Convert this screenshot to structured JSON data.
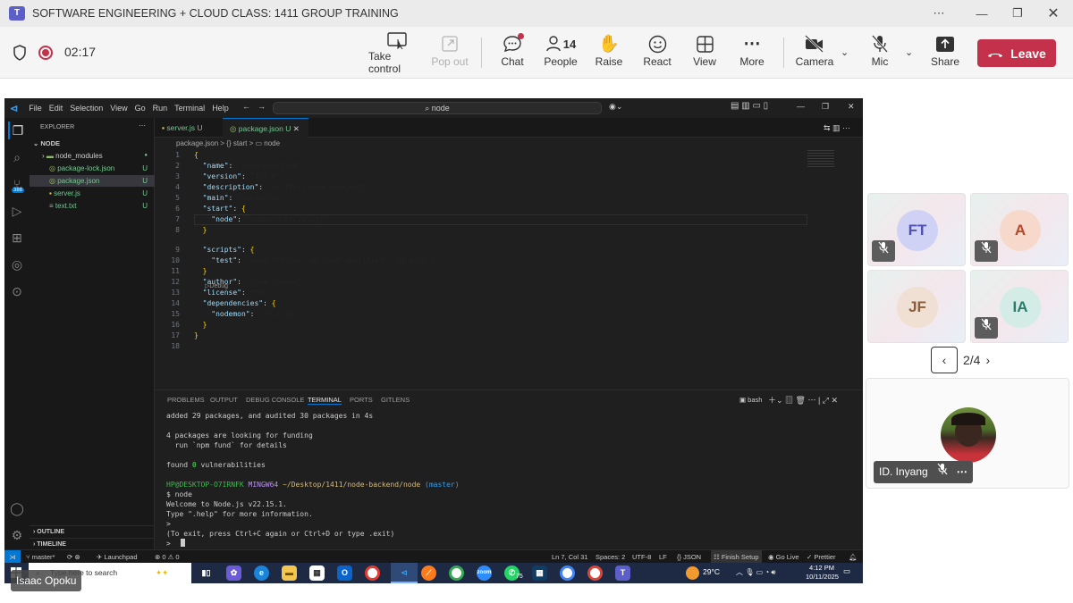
{
  "window": {
    "title": "SOFTWARE ENGINEERING + CLOUD CLASS: 1411 GROUP TRAINING"
  },
  "meeting": {
    "timer": "02:17",
    "tools": {
      "take_control": "Take control",
      "pop_out": "Pop out",
      "chat": "Chat",
      "people": "People",
      "people_count": "14",
      "raise": "Raise",
      "react": "React",
      "view": "View",
      "more": "More",
      "camera": "Camera",
      "mic": "Mic",
      "share": "Share"
    },
    "leave_label": "Leave"
  },
  "vscode": {
    "menu": [
      "File",
      "Edit",
      "Selection",
      "View",
      "Go",
      "Run",
      "Terminal",
      "Help"
    ],
    "search": "node",
    "explorer": {
      "header": "EXPLORER",
      "root": "NODE",
      "items": [
        {
          "name": "node_modules",
          "badge": "●"
        },
        {
          "name": "package-lock.json",
          "badge": "U"
        },
        {
          "name": "package.json",
          "badge": "U"
        },
        {
          "name": "server.js",
          "badge": "U"
        },
        {
          "name": "text.txt",
          "badge": "U"
        }
      ],
      "outline": "OUTLINE",
      "timeline": "TIMELINE",
      "scm_badge": "388"
    },
    "tabs": [
      {
        "label": "server.js",
        "badge": "U"
      },
      {
        "label": "package.json",
        "badge": "U"
      }
    ],
    "breadcrumb": "package.json > {} start > ▭ node",
    "code_lines": [
      "{",
      "  \"name\": \"node-practice\",",
      "  \"version\": \"1.0.0\",",
      "  \"description\": \"my first node project\",",
      "  \"main\": \"server.js\",",
      "  \"start\": {",
      "    \"node\": \"nodemon server.js\"",
      "  },",
      "  \"scripts\": {",
      "    \"test\": \"echo \\\"Error: no test specified\\\" && exit 1\"",
      "  },",
      "  \"author\": \"Isaac Opoku\",",
      "  \"license\": \"ISC\",",
      "  \"dependencies\": {",
      "    \"nodemon\": \"^3.1.10\"",
      "  }",
      "}",
      ""
    ],
    "debug_hint": "▷Debug",
    "panel_tabs": [
      "PROBLEMS",
      "OUTPUT",
      "DEBUG CONSOLE",
      "TERMINAL",
      "PORTS",
      "GITLENS"
    ],
    "terminal_shell": "bash",
    "terminal_lines": [
      "added 29 packages, and audited 30 packages in 4s",
      "",
      "4 packages are looking for funding",
      "  run `npm fund` for details",
      "",
      "found 0 vulnerabilities",
      "",
      "HP@DESKTOP-O7IRNFK MINGW64 ~/Desktop/1411/node-backend/node (master)",
      "$ node",
      "Welcome to Node.js v22.15.1.",
      "Type \".help\" for more information.",
      "> ",
      "(To exit, press Ctrl+C again or Ctrl+D or type .exit)",
      "> "
    ],
    "status": {
      "branch": "master*",
      "launchpad": "Launchpad",
      "problems": "⊗ 0 ⚠ 0",
      "position": "Ln 7, Col 31",
      "spaces": "Spaces: 2",
      "encoding": "UTF-8",
      "eol": "LF",
      "language": "{} JSON",
      "finish_setup": "Finish Setup",
      "go_live": "Go Live",
      "prettier": "✓ Prettier"
    }
  },
  "taskbar": {
    "search_placeholder": "Type here to search",
    "weather": "29°C",
    "time": "4:12 PM",
    "date": "10/11/2025",
    "badge_75": "75"
  },
  "presenter_name": "Isaac Opoku",
  "participants": [
    {
      "initials": "FT",
      "color": "#cfd2f5",
      "text": "#4f52b2",
      "muted": false
    },
    {
      "initials": "A",
      "color": "#f7d9cc",
      "text": "#b8472a",
      "muted": true
    },
    {
      "initials": "JF",
      "color": "#efe0d3",
      "text": "#8a5b3c",
      "muted": false
    },
    {
      "initials": "IA",
      "color": "#d3ece6",
      "text": "#2d7a6a",
      "muted": true
    }
  ],
  "pager": "2/4",
  "featured": {
    "name": "ID. Inyang"
  }
}
